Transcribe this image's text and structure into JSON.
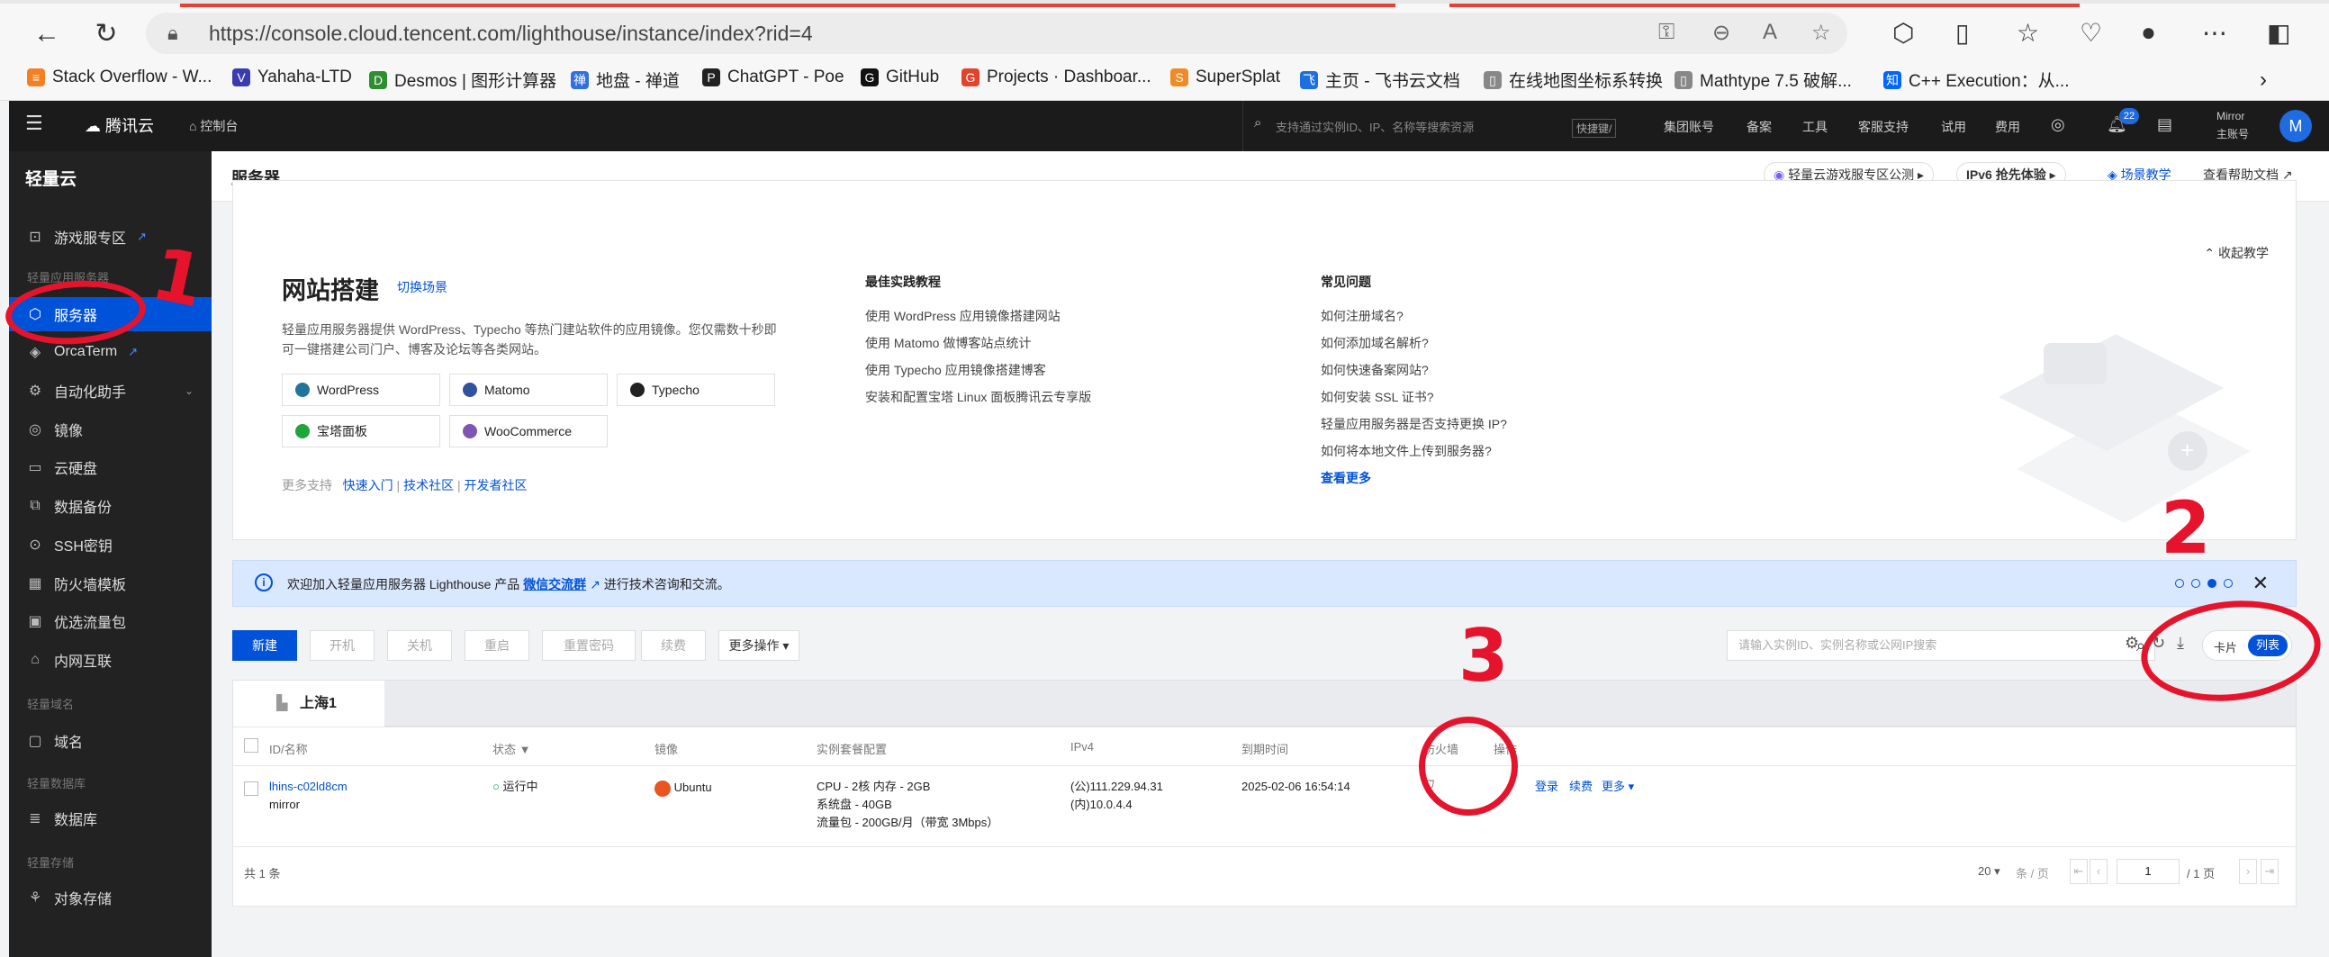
{
  "browser": {
    "url": "https://console.cloud.tencent.com/lighthouse/instance/index?rid=4",
    "bookmarks": [
      "Stack Overflow - W...",
      "Yahaha-LTD",
      "Desmos | 图形计算器",
      "地盘 - 禅道",
      "ChatGPT - Poe",
      "GitHub",
      "Projects · Dashboar...",
      "SuperSplat",
      "主页 - 飞书云文档",
      "在线地图坐标系转换",
      "Mathtype 7.5 破解...",
      "C++ Execution：从..."
    ]
  },
  "topbar": {
    "brand": "腾讯云",
    "console": "控制台",
    "search_placeholder": "支持通过实例ID、IP、名称等搜索资源",
    "shortcut": "快捷键/",
    "links": [
      "集团账号",
      "备案",
      "工具",
      "客服支持",
      "试用",
      "费用"
    ],
    "badge": "22",
    "user_name": "Mirror",
    "user_role": "主账号",
    "avatar": "M"
  },
  "sidebar": {
    "title": "轻量云",
    "items": [
      {
        "label": "游戏服专区",
        "icon": "game-icon"
      },
      {
        "label": "服务器",
        "icon": "server-icon"
      },
      {
        "label": "OrcaTerm",
        "icon": "terminal-icon"
      },
      {
        "label": "自动化助手",
        "icon": "robot-icon"
      },
      {
        "label": "镜像",
        "icon": "image-icon"
      },
      {
        "label": "云硬盘",
        "icon": "disk-icon"
      },
      {
        "label": "数据备份",
        "icon": "backup-icon"
      },
      {
        "label": "SSH密钥",
        "icon": "key-icon"
      },
      {
        "label": "防火墙模板",
        "icon": "firewall-icon"
      },
      {
        "label": "优选流量包",
        "icon": "traffic-icon"
      },
      {
        "label": "内网互联",
        "icon": "network-icon"
      },
      {
        "label": "域名",
        "icon": "domain-icon"
      },
      {
        "label": "数据库",
        "icon": "database-icon"
      },
      {
        "label": "对象存储",
        "icon": "storage-icon"
      }
    ],
    "groups": [
      "轻量应用服务器",
      "轻量域名",
      "轻量数据库",
      "轻量存储"
    ]
  },
  "header": {
    "title": "服务器",
    "game_pill": "轻量云游戏服专区公测",
    "ipv6_pill": "IPv6 抢先体验",
    "tutorial": "场景教学",
    "help": "查看帮助文档"
  },
  "intro": {
    "title": "网站搭建",
    "switch": "切换场景",
    "desc": "轻量应用服务器提供 WordPress、Typecho 等热门建站软件的应用镜像。您仅需数十秒即可一键搭建公司门户、博客及论坛等各类网站。",
    "templates": [
      "WordPress",
      "Matomo",
      "Typecho",
      "宝塔面板",
      "WooCommerce"
    ],
    "more_label": "更多支持",
    "more_links": [
      "快速入门",
      "技术社区",
      "开发者社区"
    ],
    "practice_title": "最佳实践教程",
    "practice": [
      "使用 WordPress 应用镜像搭建网站",
      "使用 Matomo 做博客站点统计",
      "使用 Typecho 应用镜像搭建博客",
      "安装和配置宝塔 Linux 面板腾讯云专享版"
    ],
    "faq_title": "常见问题",
    "faq": [
      "如何注册域名?",
      "如何添加域名解析?",
      "如何快速备案网站?",
      "如何安装 SSL 证书?",
      "轻量应用服务器是否支持更换 IP?",
      "如何将本地文件上传到服务器?"
    ],
    "faq_more": "查看更多",
    "collapse": "收起教学"
  },
  "banner": {
    "text": "欢迎加入轻量应用服务器 Lighthouse 产品",
    "link": "微信交流群",
    "text2": "进行技术咨询和交流。"
  },
  "toolbar": {
    "buttons": [
      "新建",
      "开机",
      "关机",
      "重启",
      "重置密码",
      "续费",
      "更多操作"
    ],
    "search_placeholder": "请输入实例ID、实例名称或公网IP搜索",
    "view_card": "卡片",
    "view_list": "列表"
  },
  "region": "上海1",
  "table": {
    "headers": [
      "ID/名称",
      "状态",
      "镜像",
      "实例套餐配置",
      "IPv4",
      "到期时间",
      "防火墙",
      "操作"
    ],
    "row": {
      "id": "lhins-c02ld8cm",
      "name": "mirror",
      "status": "运行中",
      "image": "Ubuntu",
      "config1": "CPU - 2核 内存 - 2GB",
      "config2": "系统盘 - 40GB",
      "config3": "流量包 - 200GB/月（带宽 3Mbps）",
      "ip_public": "(公)111.229.94.31",
      "ip_private": "(内)10.0.4.4",
      "expire": "2025-02-06 16:54:14",
      "actions": [
        "登录",
        "续费",
        "更多"
      ]
    },
    "total": "共 1 条",
    "page_size": "20",
    "per_page": "条 / 页",
    "page": "1",
    "page_total": "/ 1 页"
  },
  "annotations": [
    "1",
    "2",
    "3"
  ],
  "colors": {
    "accent": "#0052d9",
    "annotation": "#e5142c"
  }
}
